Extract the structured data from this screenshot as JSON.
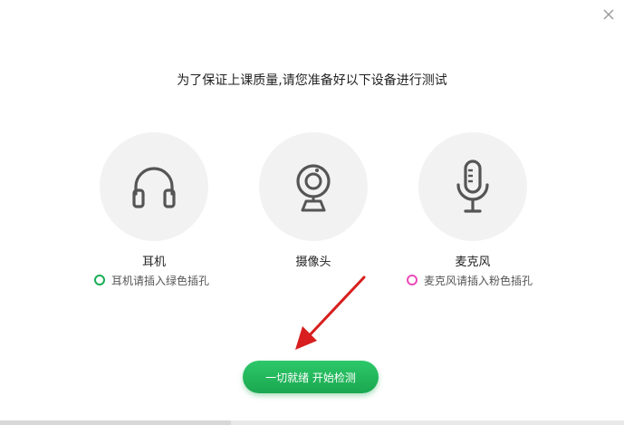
{
  "dialog": {
    "heading": "为了保证上课质量,请您准备好以下设备进行测试",
    "close_icon": "close-icon"
  },
  "devices": [
    {
      "name": "耳机",
      "icon": "headphones-icon",
      "hint": "耳机请插入绿色插孔",
      "hint_color": "#1aad55"
    },
    {
      "name": "摄像头",
      "icon": "webcam-icon"
    },
    {
      "name": "麦克风",
      "icon": "microphone-icon",
      "hint": "麦克风请插入粉色插孔",
      "hint_color": "#e84cb8"
    }
  ],
  "actions": {
    "start_label": "一切就绪 开始检测",
    "accent_color": "#1fb85c"
  },
  "annotation": {
    "arrow_color": "#d81e1e",
    "arrow_icon": "red-arrow-icon"
  }
}
